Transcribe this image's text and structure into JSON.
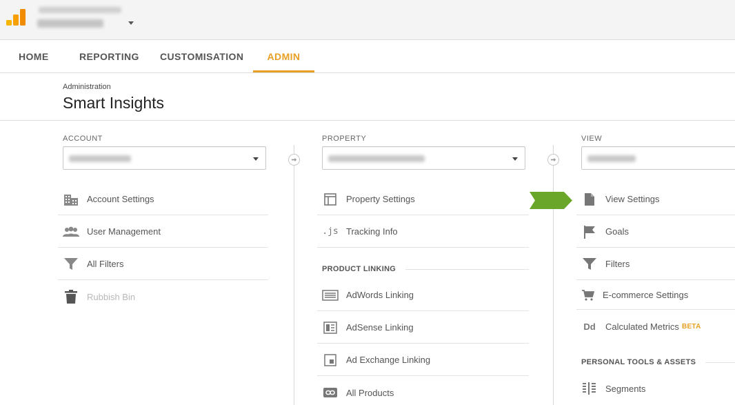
{
  "nav": {
    "tabs": [
      {
        "label": "HOME"
      },
      {
        "label": "REPORTING"
      },
      {
        "label": "CUSTOMISATION"
      },
      {
        "label": "ADMIN",
        "active": true
      }
    ]
  },
  "header": {
    "breadcrumb": "Administration",
    "title": "Smart Insights"
  },
  "account": {
    "label": "ACCOUNT",
    "items": [
      {
        "label": "Account Settings",
        "icon": "building-icon"
      },
      {
        "label": "User Management",
        "icon": "users-icon"
      },
      {
        "label": "All Filters",
        "icon": "filter-icon"
      },
      {
        "label": "Rubbish Bin",
        "icon": "trash-icon",
        "disabled": true
      }
    ]
  },
  "property": {
    "label": "PROPERTY",
    "items": [
      {
        "label": "Property Settings",
        "icon": "window-icon"
      },
      {
        "label": "Tracking Info",
        "icon": "js-icon",
        "icon_text": ".js"
      }
    ],
    "section": "PRODUCT LINKING",
    "linking": [
      {
        "label": "AdWords Linking",
        "icon": "adwords-icon"
      },
      {
        "label": "AdSense Linking",
        "icon": "adsense-icon"
      },
      {
        "label": "Ad Exchange Linking",
        "icon": "adexchange-icon"
      },
      {
        "label": "All Products",
        "icon": "link-icon"
      }
    ]
  },
  "view": {
    "label": "VIEW",
    "items": [
      {
        "label": "View Settings",
        "icon": "document-icon"
      },
      {
        "label": "Goals",
        "icon": "flag-icon"
      },
      {
        "label": "Filters",
        "icon": "filter-icon"
      },
      {
        "label": "E-commerce Settings",
        "icon": "cart-icon"
      },
      {
        "label": "Calculated Metrics",
        "icon": "dd-icon",
        "icon_text": "Dd",
        "badge": "BETA"
      }
    ],
    "section": "PERSONAL TOOLS & ASSETS",
    "tools": [
      {
        "label": "Segments",
        "icon": "segments-icon"
      }
    ]
  },
  "colors": {
    "accent": "#e8a024",
    "arrow_green": "#6aa629",
    "logo_orange": "#f9ab00"
  }
}
